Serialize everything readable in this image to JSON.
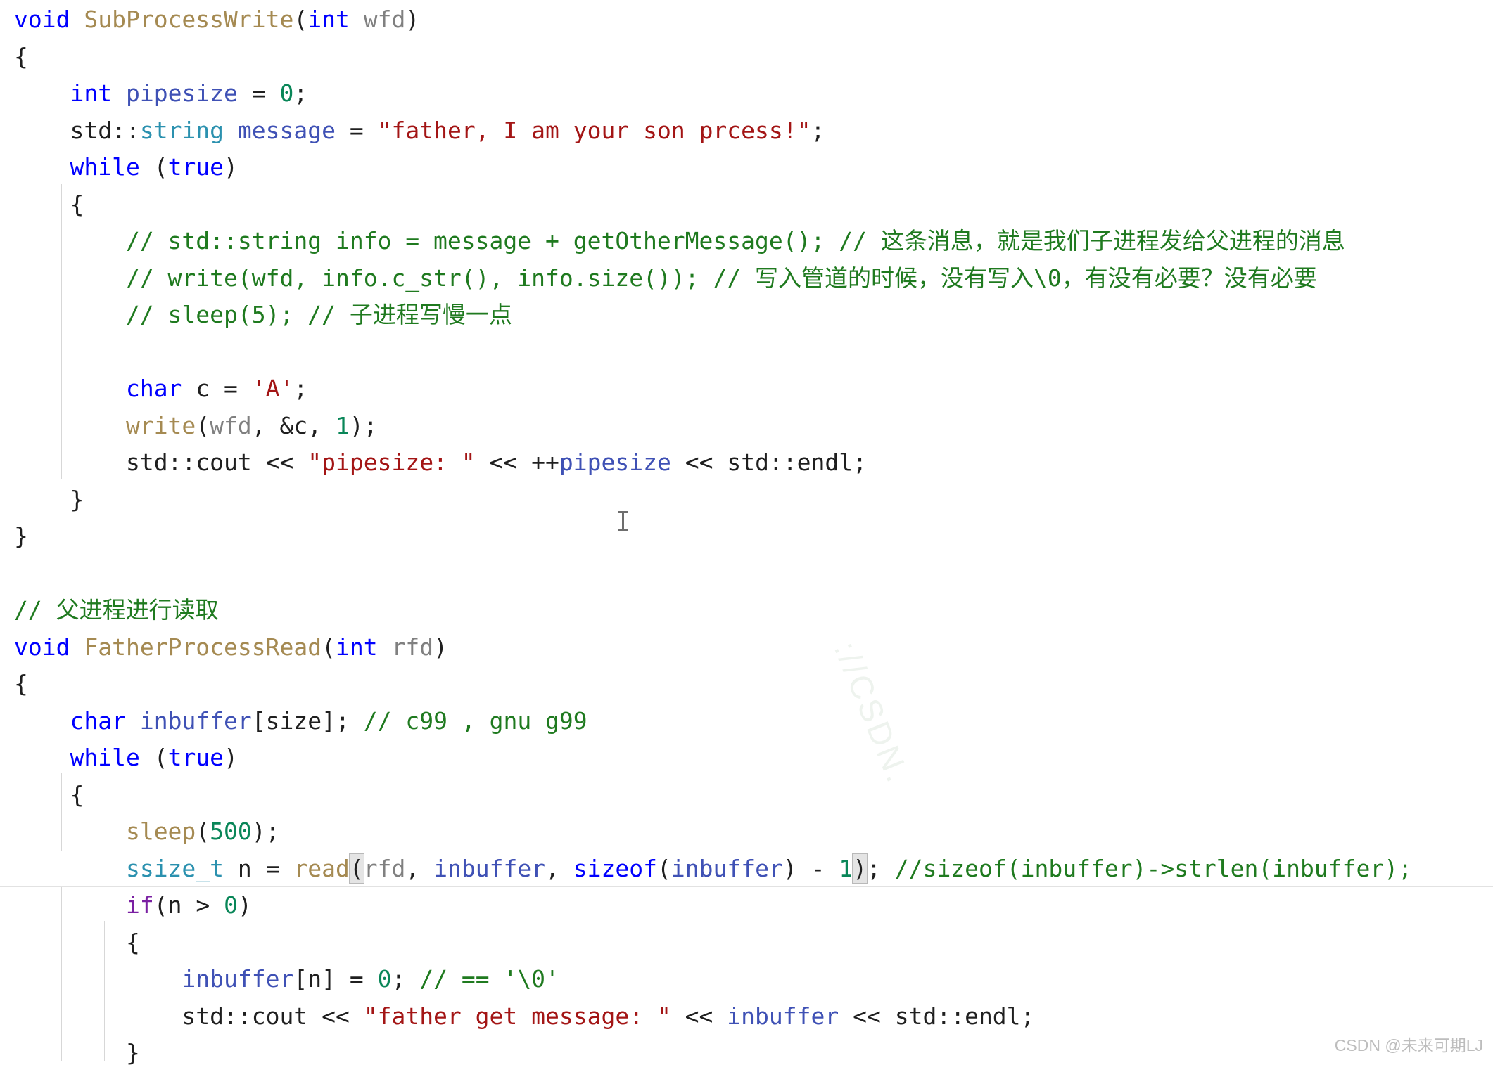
{
  "editor": {
    "language": "cpp",
    "background_color": "#ffffff",
    "colors": {
      "keyword": "#0000ff",
      "keyword_control": "#7a1fa2",
      "function": "#a58a52",
      "parameter": "#808080",
      "variable": "#3f51b5",
      "type": "#2b91af",
      "string": "#a31515",
      "number": "#098658",
      "comment": "#1f7a1f",
      "plain": "#1f1f1f",
      "indent_guide": "#d7d7d7",
      "bracket_match_bg": "#e4e4e4",
      "highlight_border": "#e2e2e2"
    },
    "cursor_icon": "text-ibeam-cursor",
    "highlighted_line_number": 25
  },
  "code": {
    "lines": [
      {
        "id": 1,
        "text": "void SubProcessWrite(int wfd)"
      },
      {
        "id": 2,
        "text": "{"
      },
      {
        "id": 3,
        "text": "    int pipesize = 0;"
      },
      {
        "id": 4,
        "text": "    std::string message = \"father, I am your son prcess!\";"
      },
      {
        "id": 5,
        "text": "    while (true)"
      },
      {
        "id": 6,
        "text": "    {"
      },
      {
        "id": 7,
        "text": "        // std::string info = message + getOtherMessage(); // 这条消息，就是我们子进程发给父进程的消息"
      },
      {
        "id": 8,
        "text": "        // write(wfd, info.c_str(), info.size()); // 写入管道的时候，没有写入\\0，有没有必要？没有必要"
      },
      {
        "id": 9,
        "text": "        // sleep(5); // 子进程写慢一点"
      },
      {
        "id": 10,
        "text": ""
      },
      {
        "id": 11,
        "text": "        char c = 'A';"
      },
      {
        "id": 12,
        "text": "        write(wfd, &c, 1);"
      },
      {
        "id": 13,
        "text": "        std::cout << \"pipesize: \" << ++pipesize << std::endl;"
      },
      {
        "id": 14,
        "text": "    }"
      },
      {
        "id": 15,
        "text": "}"
      },
      {
        "id": 16,
        "text": ""
      },
      {
        "id": 17,
        "text": "// 父进程进行读取"
      },
      {
        "id": 18,
        "text": "void FatherProcessRead(int rfd)"
      },
      {
        "id": 19,
        "text": "{"
      },
      {
        "id": 20,
        "text": "    char inbuffer[size]; // c99 , gnu g99"
      },
      {
        "id": 21,
        "text": "    while (true)"
      },
      {
        "id": 22,
        "text": "    {"
      },
      {
        "id": 23,
        "text": "        sleep(500);"
      },
      {
        "id": 24,
        "text": "        ssize_t n = read(rfd, inbuffer, sizeof(inbuffer) - 1); //sizeof(inbuffer)->strlen(inbuffer);"
      },
      {
        "id": 25,
        "text": "        if(n > 0)"
      },
      {
        "id": 26,
        "text": "        {"
      },
      {
        "id": 27,
        "text": "            inbuffer[n] = 0; // == '\\0'"
      },
      {
        "id": 28,
        "text": "            std::cout << \"father get message: \" << inbuffer << std::endl;"
      },
      {
        "id": 29,
        "text": "        }"
      }
    ],
    "tokens": {
      "fn_subprocesswrite": "SubProcessWrite",
      "fn_fatherprocessread": "FatherProcessRead",
      "fn_write": "write",
      "fn_read": "read",
      "fn_sleep": "sleep",
      "kw_void": "void",
      "kw_int": "int",
      "kw_char": "char",
      "kw_while": "while",
      "kw_true": "true",
      "kw_if": "if",
      "kw_sizeof": "sizeof",
      "type_string": "string",
      "type_ssize_t": "ssize_t",
      "param_wfd": "wfd",
      "param_rfd": "rfd",
      "var_pipesize": "pipesize",
      "var_message": "message",
      "var_inbuffer": "inbuffer",
      "var_c": "c",
      "var_n": "n",
      "macro_size": "size",
      "str_message": "\"father, I am your son prcess!\"",
      "str_pipesize": "\"pipesize: \"",
      "str_father_get": "\"father get message: \"",
      "char_a": "'A'",
      "num_0": "0",
      "num_1": "1",
      "num_500": "500",
      "std_cout": "std::cout",
      "std_endl": "std::endl",
      "std_prefix": "std::",
      "cmt_info": "// std::string info = message + getOtherMessage(); ",
      "cmt_info_cn": "// 这条消息，就是我们子进程发给父进程的消息",
      "cmt_write": "// write(wfd, info.c_str(), info.size()); ",
      "cmt_write_cn": "// 写入管道的时候，没有写入\\0，有没有必要？没有必要",
      "cmt_sleep": "// sleep(5); ",
      "cmt_sleep_cn": "// 子进程写慢一点",
      "cmt_father": "// 父进程进行读取",
      "cmt_c99": "// c99 , gnu g99",
      "cmt_sizeof": "//sizeof(inbuffer)->strlen(inbuffer);",
      "cmt_nullterm": "// == '\\0'"
    }
  },
  "watermark": {
    "text": "://CSDN.",
    "color": "#eef3ee"
  },
  "footer": {
    "credit": "CSDN @未来可期LJ"
  }
}
